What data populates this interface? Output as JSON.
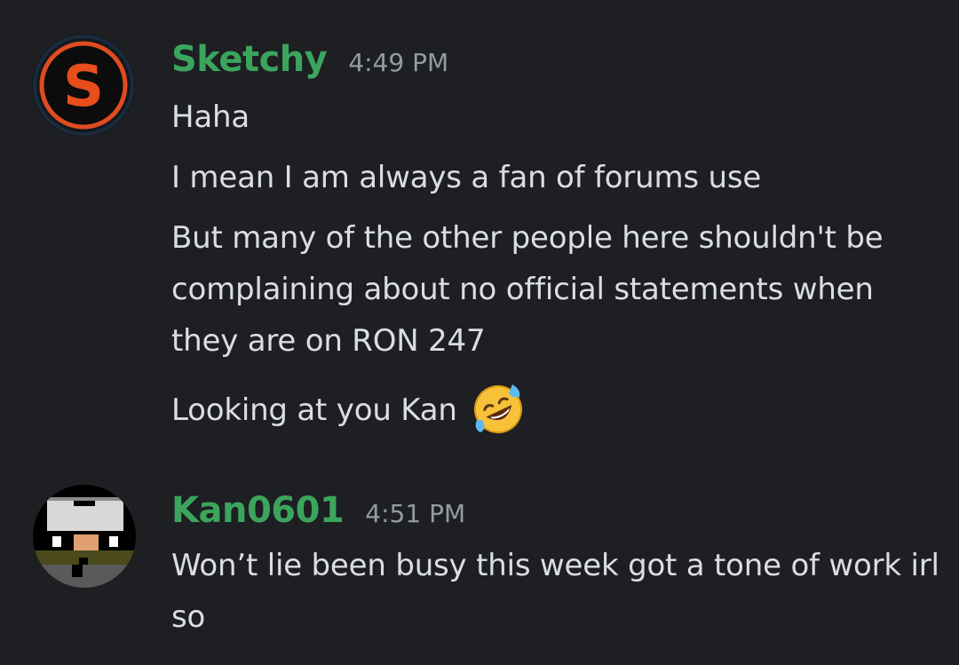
{
  "messages": [
    {
      "username": "Sketchy",
      "timestamp": "4:49 PM",
      "avatar_icon": "letter-s-logo-icon",
      "avatar_letter": "S",
      "lines": [
        "Haha",
        "I mean I am always a fan of forums use",
        "But many of the other people here shouldn't be complaining about no official statements when they are on RON 247",
        "Looking at you Kan"
      ],
      "emoji": "rolling-on-floor-laughing-emoji"
    },
    {
      "username": "Kan0601",
      "timestamp": "4:51 PM",
      "avatar_icon": "pixel-art-avatar-icon",
      "lines": [
        "Won’t lie been busy this week got a tone of work irl so"
      ]
    }
  ],
  "colors": {
    "background": "#1e1f22",
    "username": "#3ba55d",
    "timestamp": "#949ba4",
    "message_text": "#dbdee1"
  }
}
